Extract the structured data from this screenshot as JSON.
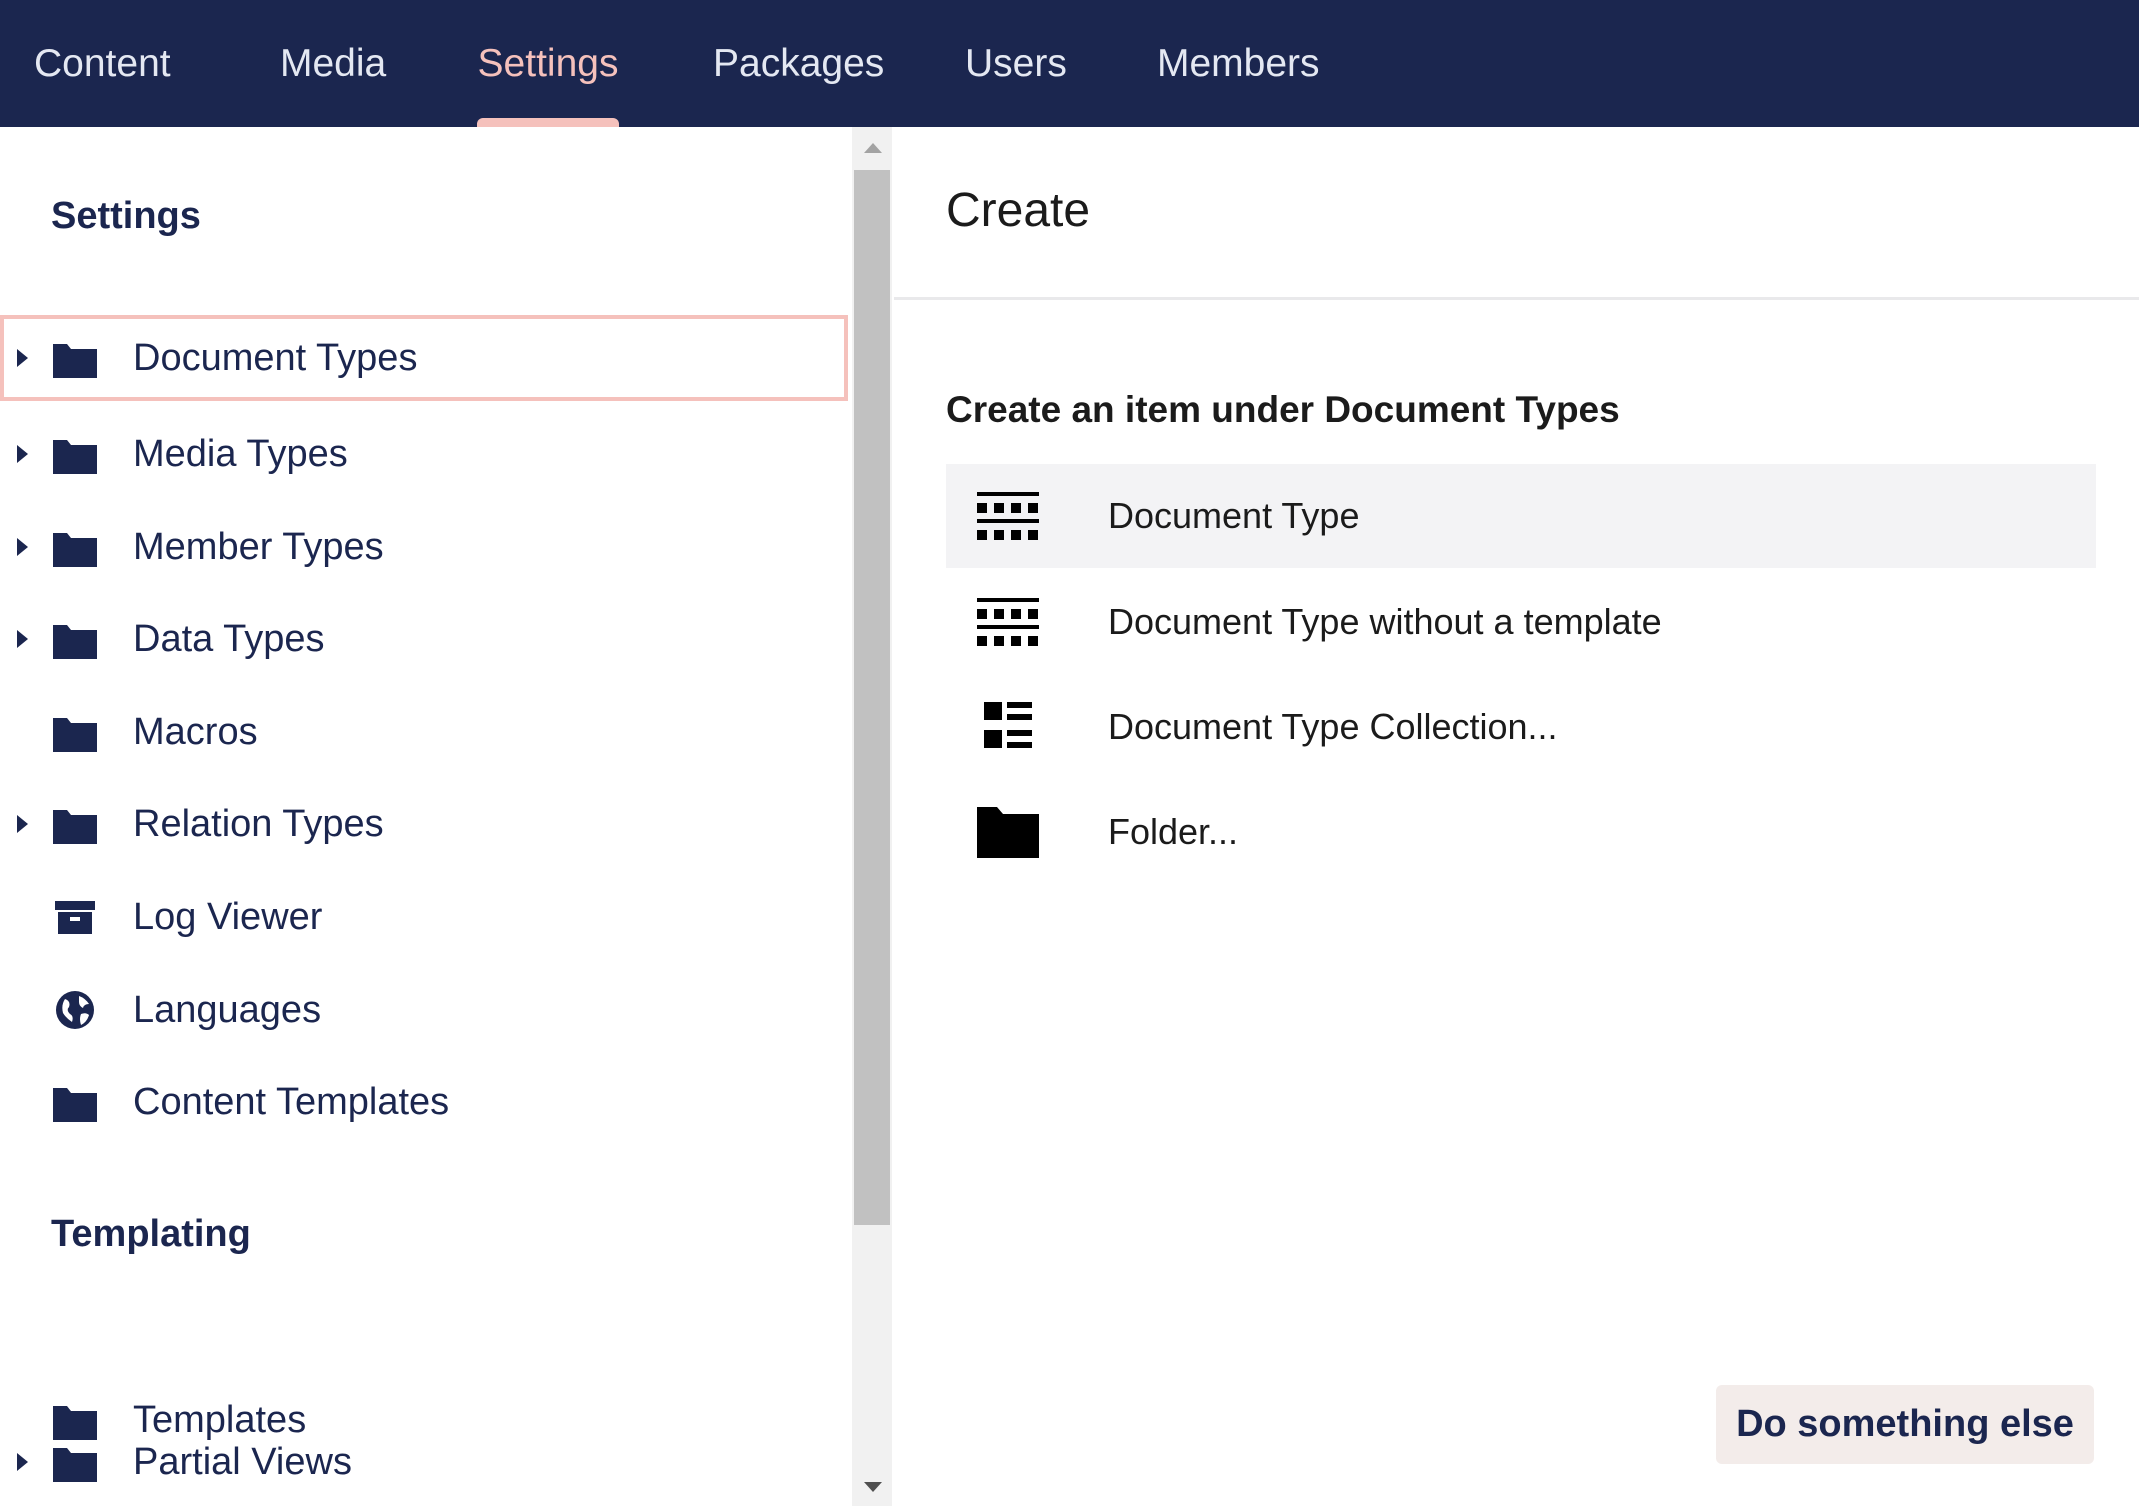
{
  "topnav": {
    "tabs": [
      {
        "label": "Content"
      },
      {
        "label": "Media"
      },
      {
        "label": "Settings"
      },
      {
        "label": "Packages"
      },
      {
        "label": "Users"
      },
      {
        "label": "Members"
      }
    ],
    "active_tab": "Settings"
  },
  "tree": {
    "settings_title": "Settings",
    "settings_items": [
      {
        "label": "Document Types",
        "icon": "folder-icon",
        "has_children": true,
        "selected": true
      },
      {
        "label": "Media Types",
        "icon": "folder-icon",
        "has_children": true
      },
      {
        "label": "Member Types",
        "icon": "folder-icon",
        "has_children": true
      },
      {
        "label": "Data Types",
        "icon": "folder-icon",
        "has_children": true
      },
      {
        "label": "Macros",
        "icon": "folder-icon",
        "has_children": false
      },
      {
        "label": "Relation Types",
        "icon": "folder-icon",
        "has_children": true
      },
      {
        "label": "Log Viewer",
        "icon": "archive-box-icon",
        "has_children": false
      },
      {
        "label": "Languages",
        "icon": "globe-icon",
        "has_children": false
      },
      {
        "label": "Content Templates",
        "icon": "folder-icon",
        "has_children": false
      }
    ],
    "templating_title": "Templating",
    "templating_items": [
      {
        "label": "Templates",
        "icon": "folder-icon",
        "has_children": false
      },
      {
        "label": "Partial Views",
        "icon": "folder-icon",
        "has_children": true
      }
    ]
  },
  "panel": {
    "title": "Create",
    "subtitle": "Create an item under Document Types",
    "options": [
      {
        "label": "Document Type",
        "icon": "document-type-icon"
      },
      {
        "label": "Document Type without a template",
        "icon": "document-type-icon"
      },
      {
        "label": "Document Type Collection...",
        "icon": "collection-icon"
      },
      {
        "label": "Folder...",
        "icon": "folder-icon"
      }
    ],
    "secondary_button": "Do something else"
  },
  "colors": {
    "nav_background": "#1b264f",
    "accent": "#f5c1bc",
    "text_dark": "#1b264f"
  }
}
